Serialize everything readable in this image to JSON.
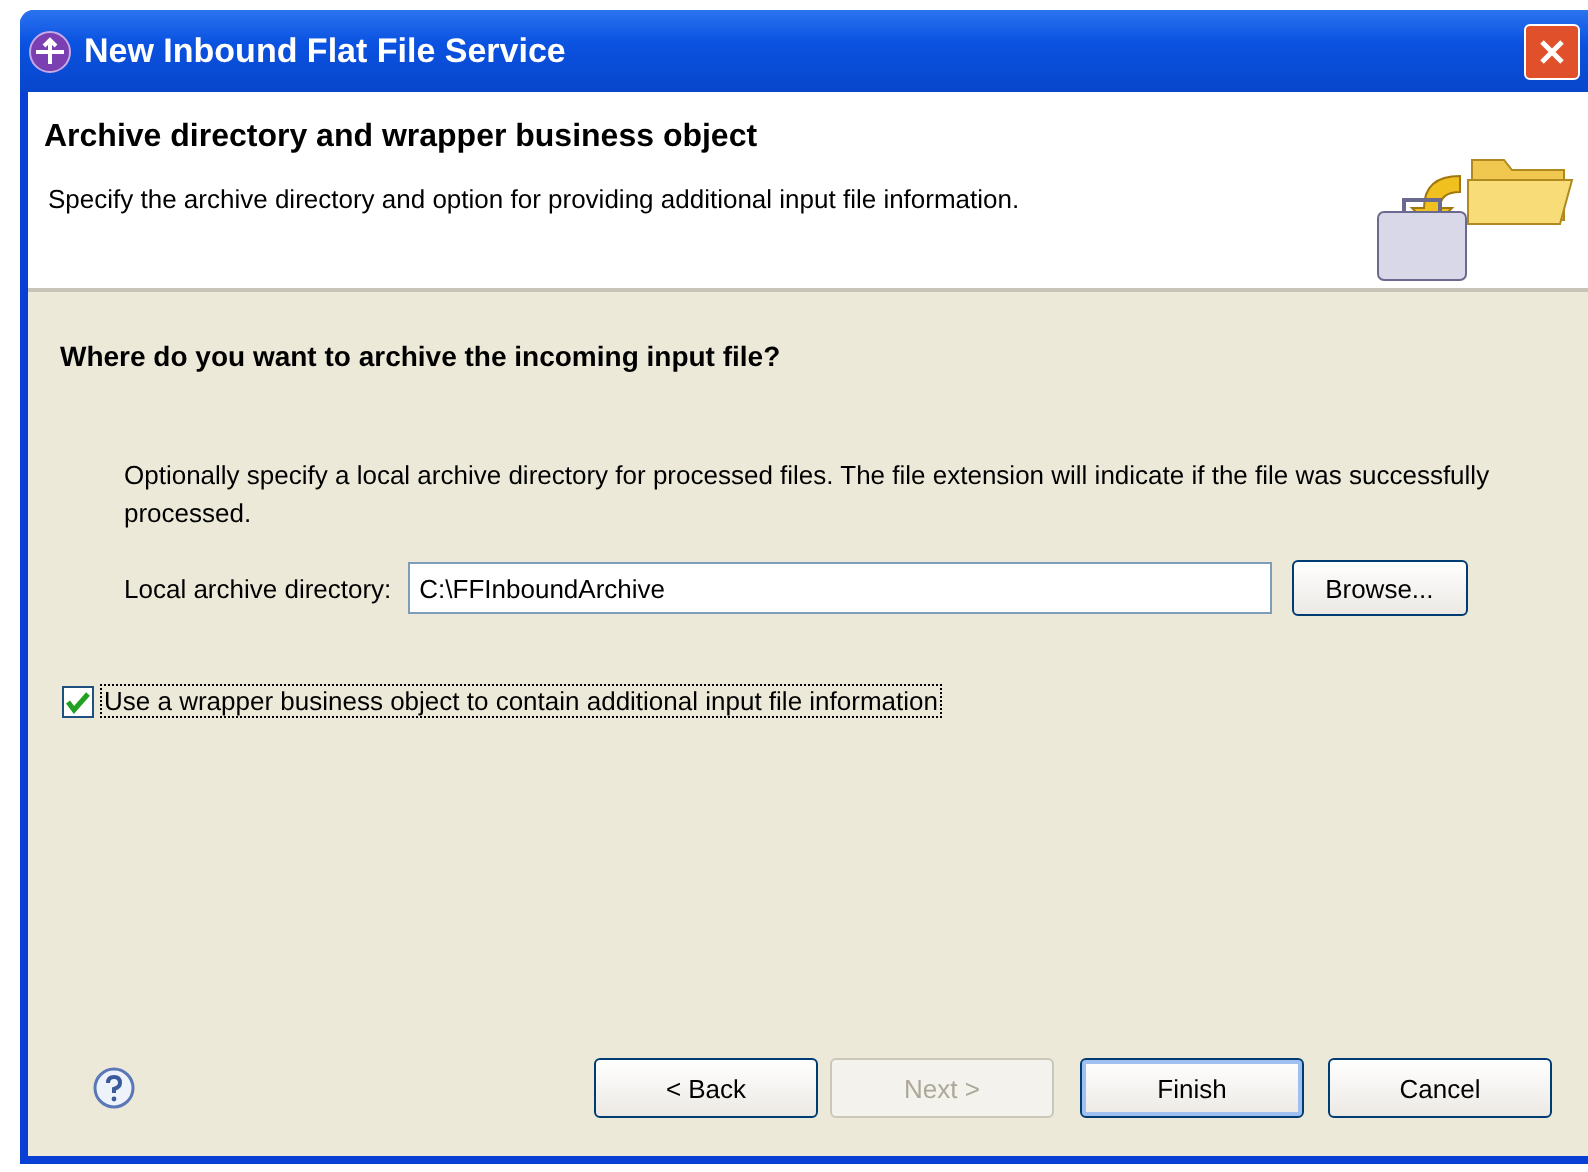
{
  "window": {
    "title": "New Inbound Flat File Service"
  },
  "header": {
    "title": "Archive directory and wrapper business object",
    "description": "Specify the archive directory and option for providing additional input file information."
  },
  "section": {
    "heading": "Where do you want to archive the incoming input file?",
    "description": "Optionally specify a local archive directory for processed files.  The file extension will indicate if the file was successfully processed.",
    "field": {
      "label": "Local archive directory:",
      "value": "C:\\FFInboundArchive"
    },
    "browse_button": "Browse..."
  },
  "wrapper_option": {
    "label": "Use a wrapper business object to contain additional input file information",
    "checked": true
  },
  "buttons": [
    {
      "label": "< Back",
      "disabled": false,
      "default": false
    },
    {
      "label": "Next >",
      "disabled": true,
      "default": false
    },
    {
      "label": "Finish",
      "disabled": false,
      "default": true
    },
    {
      "label": "Cancel",
      "disabled": false,
      "default": false
    }
  ]
}
